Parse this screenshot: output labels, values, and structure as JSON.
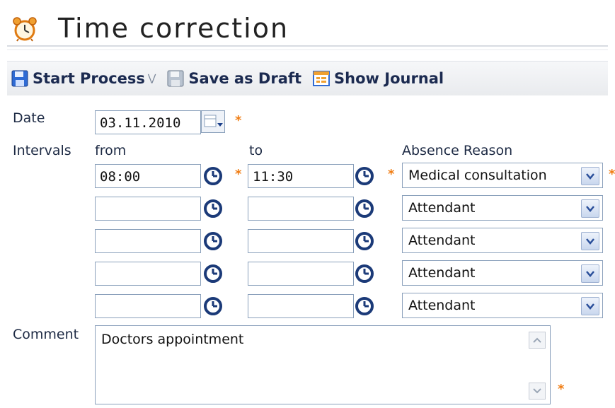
{
  "window": {
    "title": "Time correction",
    "title_icon": "alarm-clock-icon"
  },
  "toolbar": {
    "start_process": {
      "label": "Start Process",
      "icon": "save-icon"
    },
    "save_draft": {
      "label": "Save as Draft",
      "icon": "disk-icon"
    },
    "show_journal": {
      "label": "Show Journal",
      "icon": "journal-icon"
    }
  },
  "form": {
    "date_label": "Date",
    "date_value": "03.11.2010",
    "intervals_label": "Intervals",
    "from_label": "from",
    "to_label": "to",
    "absence_reason_label": "Absence Reason",
    "required_marker": "*",
    "rows": [
      {
        "from": "08:00",
        "to": "11:30",
        "reason": "Medical consultation"
      },
      {
        "from": "",
        "to": "",
        "reason": "Attendant"
      },
      {
        "from": "",
        "to": "",
        "reason": "Attendant"
      },
      {
        "from": "",
        "to": "",
        "reason": "Attendant"
      },
      {
        "from": "",
        "to": "",
        "reason": "Attendant"
      }
    ],
    "comment_label": "Comment",
    "comment_value": "Doctors appointment"
  },
  "colors": {
    "accent": "#f07c12",
    "label": "#1d2a44",
    "border": "#8aa0bb"
  }
}
